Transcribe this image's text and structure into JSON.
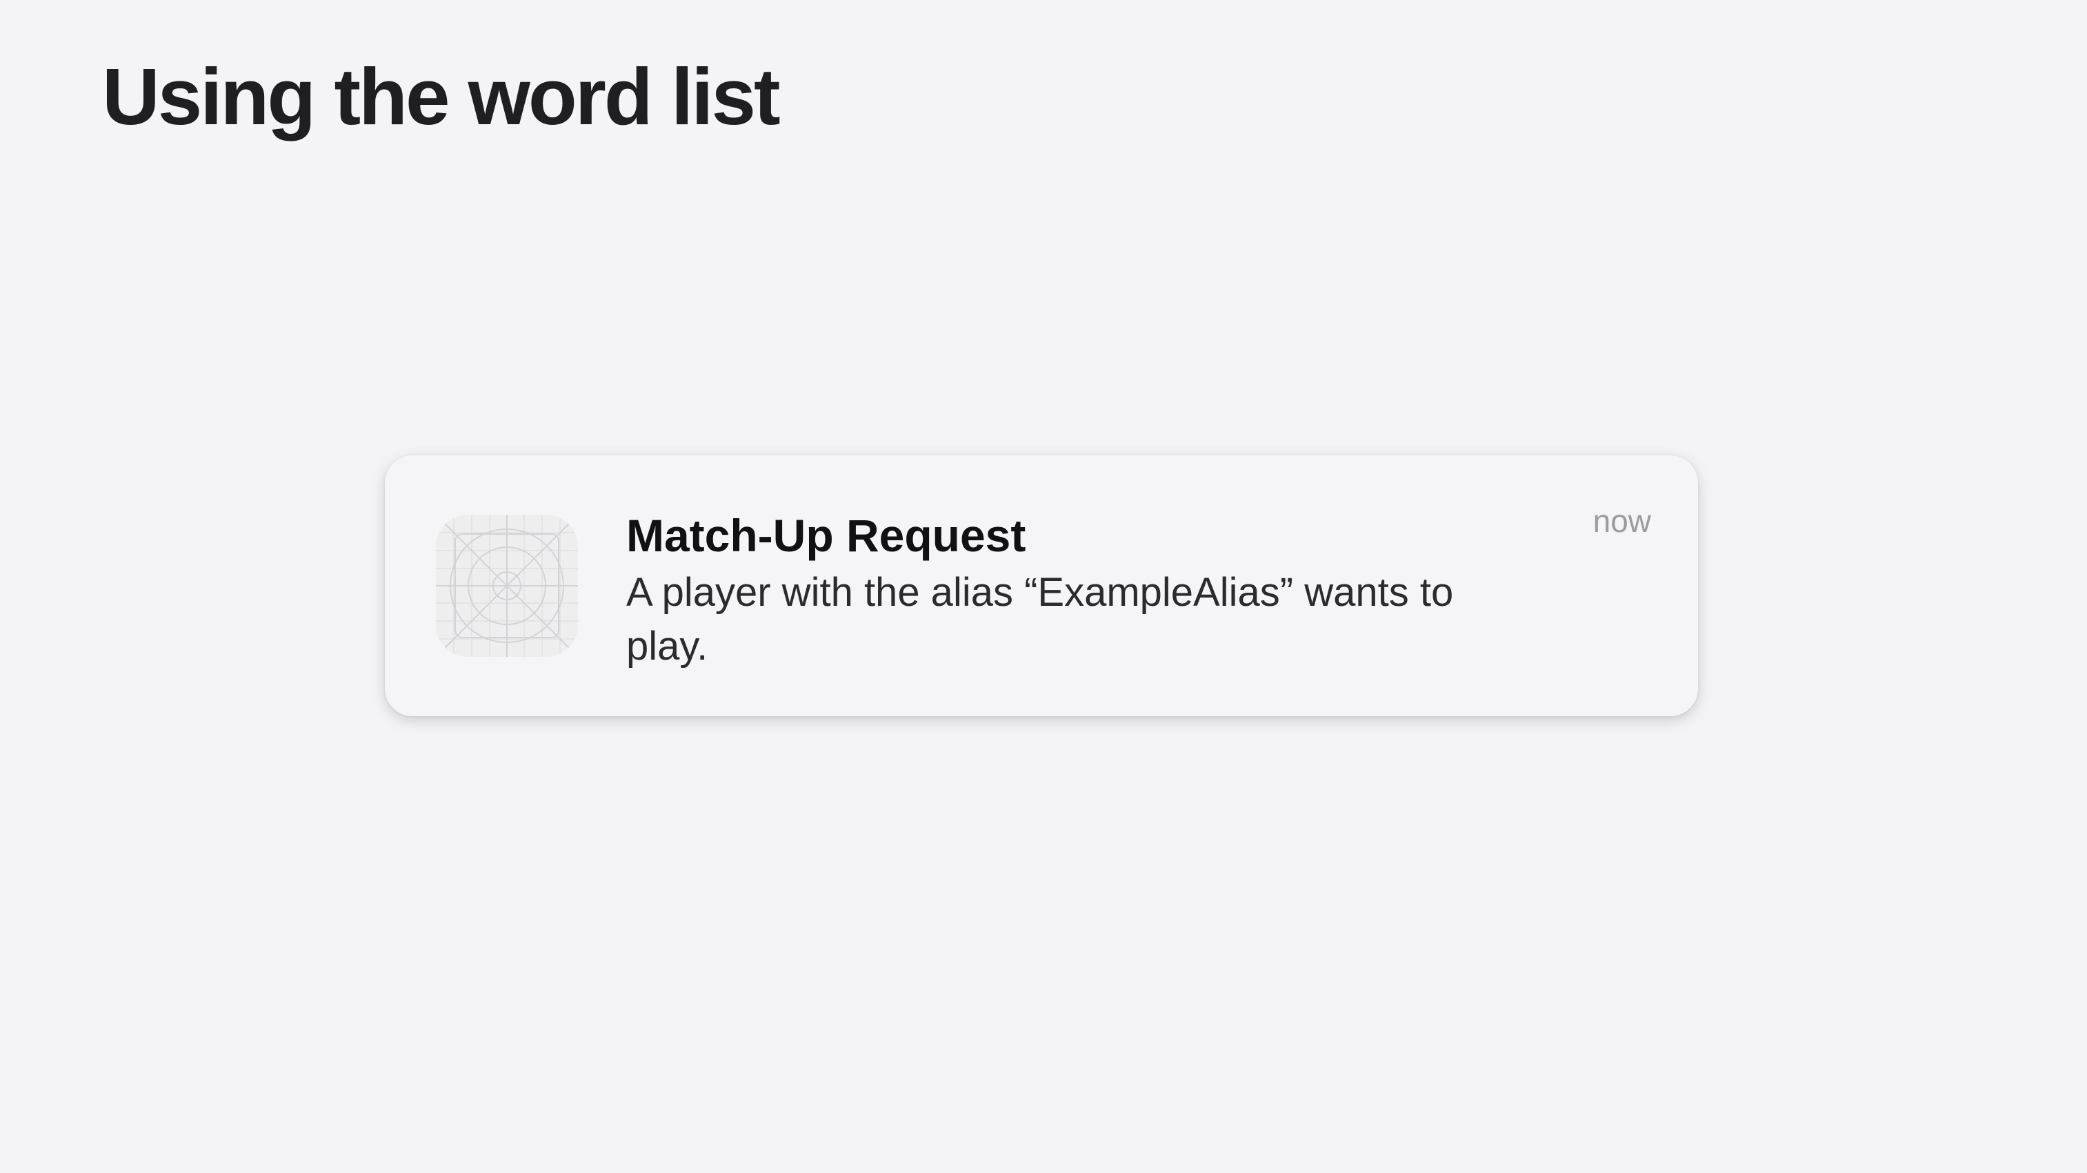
{
  "slide": {
    "title": "Using the word list"
  },
  "notification": {
    "app_icon": "app-icon-placeholder-grid",
    "title": "Match-Up Request",
    "body": "A player with the alias “ExampleAlias” wants to play.",
    "time": "now"
  },
  "colors": {
    "background": "#f4f4f6",
    "card": "#f5f5f7",
    "title_text": "#1f1f21",
    "timestamp_text": "#9b9ba0"
  }
}
